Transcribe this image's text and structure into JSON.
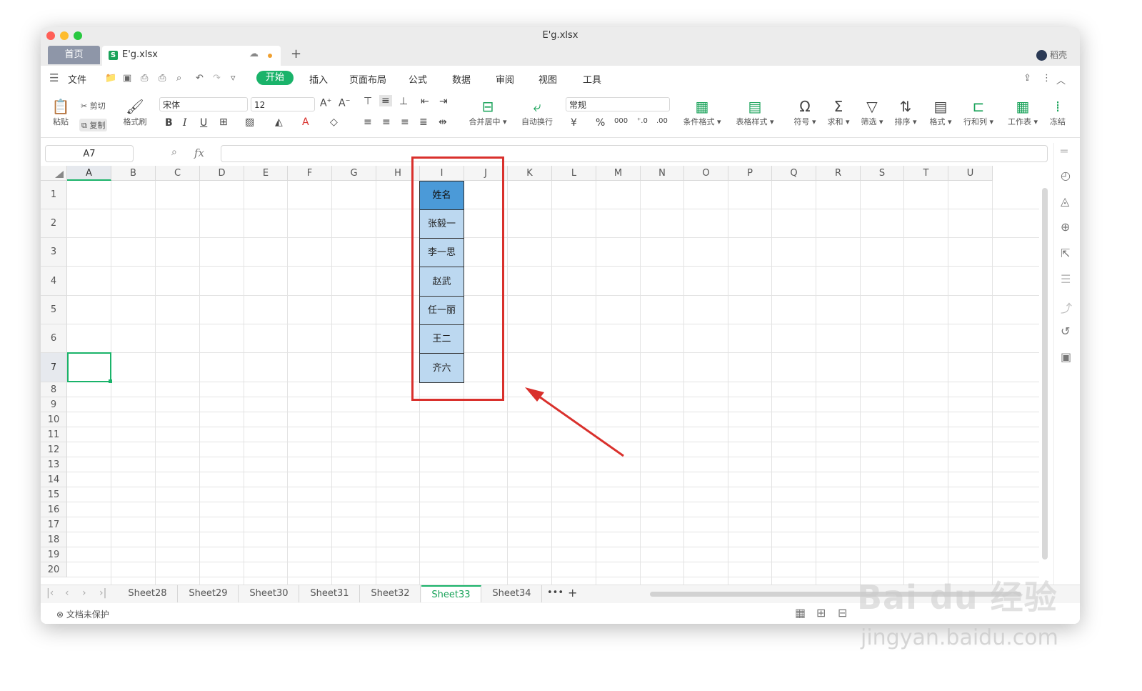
{
  "window": {
    "title": "E'g.xlsx"
  },
  "tabs": {
    "home": "首页",
    "doc": "E'g.xlsx",
    "sheet_icon": "S"
  },
  "user": {
    "name": "稻壳"
  },
  "menu": {
    "file": "文件",
    "items": [
      "开始",
      "插入",
      "页面布局",
      "公式",
      "数据",
      "审阅",
      "视图",
      "工具"
    ]
  },
  "ribbon": {
    "paste": "粘贴",
    "cut": "剪切",
    "copy": "复制",
    "format_painter": "格式刷",
    "font": "宋体",
    "font_size": "12",
    "merge": "合并居中",
    "wrap": "自动换行",
    "number_format": "常规",
    "cond_format": "条件格式",
    "table_style": "表格样式",
    "symbol": "符号",
    "sum": "求和",
    "filter": "筛选",
    "sort": "排序",
    "format": "格式",
    "rowcol": "行和列",
    "worksheet": "工作表",
    "freeze": "冻结"
  },
  "formula_bar": {
    "name_box": "A7",
    "fx": "fx",
    "value": ""
  },
  "columns": [
    "A",
    "B",
    "C",
    "D",
    "E",
    "F",
    "G",
    "H",
    "I",
    "J",
    "K",
    "L",
    "M",
    "N",
    "O",
    "P",
    "Q",
    "R",
    "S",
    "T",
    "U"
  ],
  "rows": [
    "1",
    "2",
    "3",
    "4",
    "5",
    "6",
    "7",
    "8",
    "9",
    "10",
    "11",
    "12",
    "13",
    "14",
    "15",
    "16",
    "17",
    "18",
    "19",
    "20"
  ],
  "table": {
    "header": "姓名",
    "names": [
      "张毅一",
      "李一思",
      "赵武",
      "任一丽",
      "王二",
      "齐六"
    ]
  },
  "sheets": {
    "tabs": [
      "Sheet28",
      "Sheet29",
      "Sheet30",
      "Sheet31",
      "Sheet32",
      "Sheet33",
      "Sheet34"
    ],
    "active": "Sheet33",
    "more": "•••",
    "add": "+"
  },
  "status": {
    "protect": "文档未保护"
  },
  "watermark": {
    "logo": "Bai du 经验",
    "url": "jingyan.baidu.com"
  },
  "colors": {
    "accent": "#1ab36a",
    "header_fill": "#4b9ad8",
    "cell_fill": "#bcd8f0",
    "annotation": "#d9302c"
  }
}
